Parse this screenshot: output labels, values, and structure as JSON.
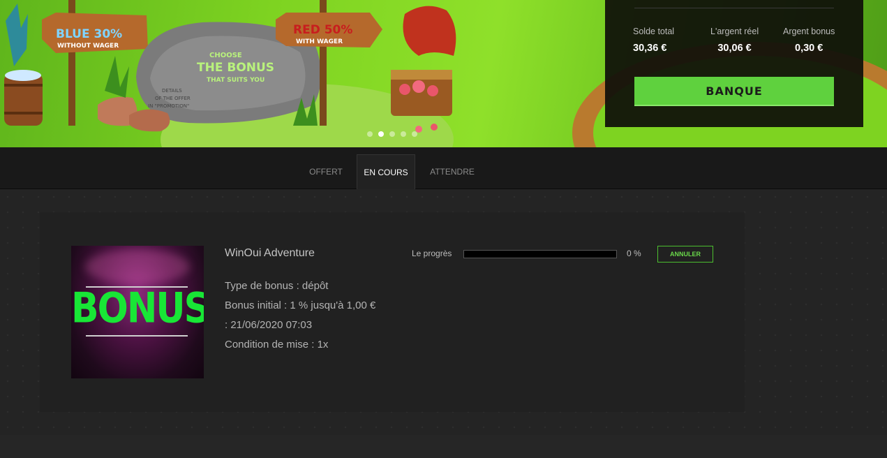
{
  "banner": {
    "signs": {
      "blue": "BLUE 30%",
      "blue_sub": "WITHOUT WAGER",
      "red": "RED 50%",
      "red_sub": "WITH WAGER",
      "stone_line1": "CHOOSE",
      "stone_line2": "THE BONUS",
      "stone_line3": "THAT SUITS YOU",
      "details1": "DETAILS",
      "details2": "OF THE OFFER",
      "details3": "IN \"PROMOTION\""
    },
    "slides": 5,
    "active_slide": 2
  },
  "balance": {
    "total_label": "Solde total",
    "total_value": "30,36 €",
    "real_label": "L'argent réel",
    "real_value": "30,06 €",
    "bonus_label": "Argent bonus",
    "bonus_value": "0,30 €",
    "bank_button": "BANQUE"
  },
  "tabs": [
    {
      "label": "OFFERT"
    },
    {
      "label": "EN COURS"
    },
    {
      "label": "ATTENDRE"
    }
  ],
  "active_tab": "EN COURS",
  "offer": {
    "image_text": "BONUS",
    "title": "WinOui Adventure",
    "type": "Type de bonus : dépôt",
    "initial": "Bonus initial : 1 % jusqu'à 1,00 €",
    "date": ": 21/06/2020 07:03",
    "wager": "Condition de mise : 1x",
    "progress_label": "Le progrès",
    "progress_percent": 0,
    "progress_text": "0 %",
    "cancel_button": "ANNULER"
  },
  "colors": {
    "accent_green": "#5fd13e",
    "bonus_green": "#18e636",
    "panel_dark": "#212121"
  }
}
